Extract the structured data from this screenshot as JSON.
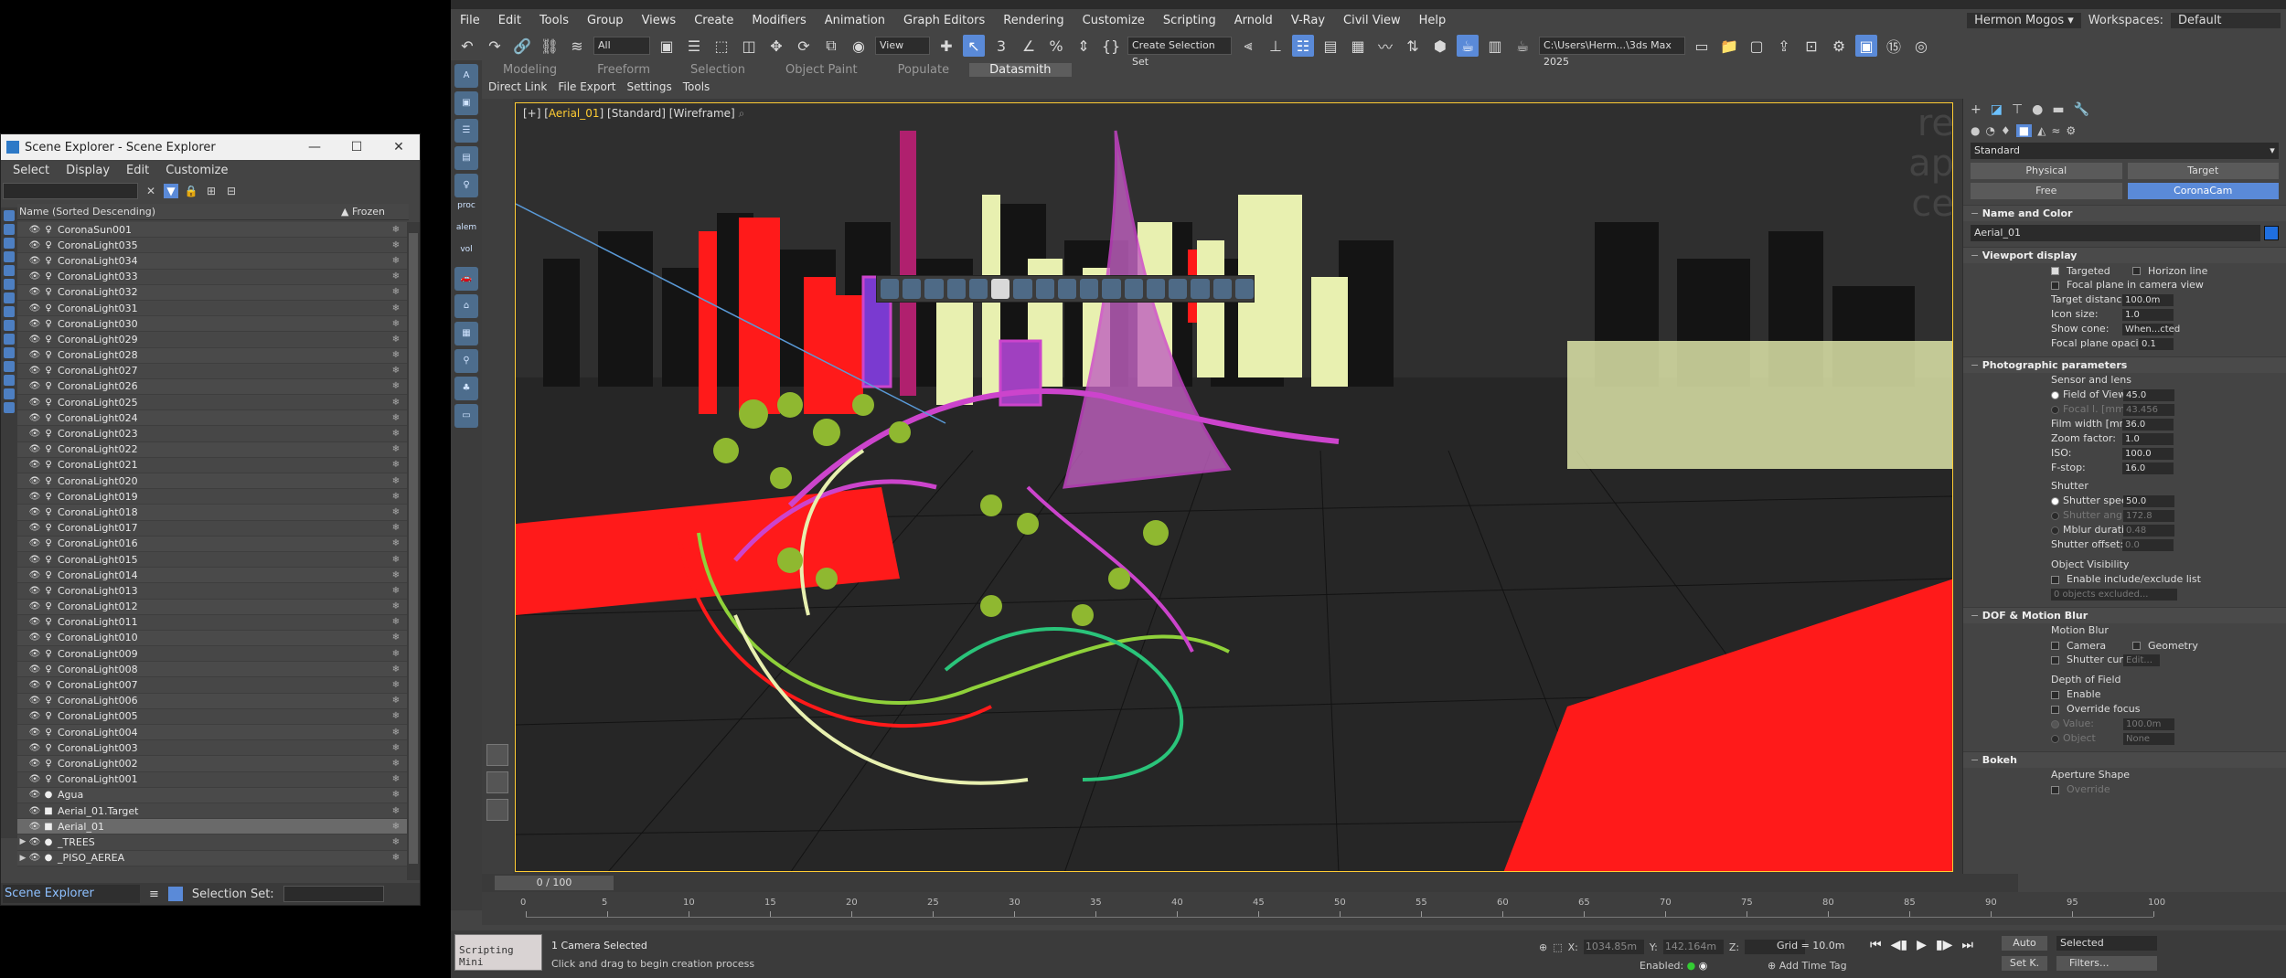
{
  "scene_explorer": {
    "title": "Scene Explorer - Scene Explorer",
    "menu": [
      "Select",
      "Display",
      "Edit",
      "Customize"
    ],
    "col_name": "Name (Sorted Descending)",
    "col_frozen": "Frozen",
    "rows": [
      "CoronaSun001",
      "CoronaLight035",
      "CoronaLight034",
      "CoronaLight033",
      "CoronaLight032",
      "CoronaLight031",
      "CoronaLight030",
      "CoronaLight029",
      "CoronaLight028",
      "CoronaLight027",
      "CoronaLight026",
      "CoronaLight025",
      "CoronaLight024",
      "CoronaLight023",
      "CoronaLight022",
      "CoronaLight021",
      "CoronaLight020",
      "CoronaLight019",
      "CoronaLight018",
      "CoronaLight017",
      "CoronaLight016",
      "CoronaLight015",
      "CoronaLight014",
      "CoronaLight013",
      "CoronaLight012",
      "CoronaLight011",
      "CoronaLight010",
      "CoronaLight009",
      "CoronaLight008",
      "CoronaLight007",
      "CoronaLight006",
      "CoronaLight005",
      "CoronaLight004",
      "CoronaLight003",
      "CoronaLight002",
      "CoronaLight001",
      "Agua",
      "Aerial_01.Target",
      "Aerial_01",
      "_TREES",
      "_PISO_AEREA"
    ],
    "selected_row": "Aerial_01",
    "footer_name": "Scene Explorer",
    "selection_set_label": "Selection Set:"
  },
  "max": {
    "menu": [
      "File",
      "Edit",
      "Tools",
      "Group",
      "Views",
      "Create",
      "Modifiers",
      "Animation",
      "Graph Editors",
      "Rendering",
      "Customize",
      "Scripting",
      "Arnold",
      "V-Ray",
      "Civil View",
      "Help"
    ],
    "user": "Hermon Mogos",
    "workspaces_label": "Workspaces:",
    "workspace": "Default",
    "filter_all": "All",
    "ref_coord": "View",
    "selset": "Create Selection Set",
    "path": "C:\\Users\\Herm...\\3ds Max 2025",
    "ribbon_tabs": [
      "Modeling",
      "Freeform",
      "Selection",
      "Object Paint",
      "Populate",
      "Datasmith"
    ],
    "ribbon_active": "Datasmith",
    "subribbon": [
      "Direct Link",
      "File Export",
      "Settings",
      "Tools"
    ],
    "left_labels": [
      "proc",
      "alem",
      "vol"
    ]
  },
  "viewport": {
    "label_prefix": "[+] [",
    "camera": "Aerial_01",
    "label_suffix": "] [Standard] [Wireframe]",
    "ghost_text": [
      "re",
      "ap",
      "ce"
    ]
  },
  "command_panel": {
    "type_dropdown": "Standard",
    "btn_physical": "Physical",
    "btn_target": "Target",
    "btn_free": "Free",
    "btn_coronacam": "CoronaCam",
    "name_color_header": "Name and Color",
    "object_name": "Aerial_01",
    "viewport_display_header": "Viewport display",
    "cb_targeted": "Targeted",
    "cb_horizon": "Horizon line",
    "cb_focal_plane": "Focal plane in camera view",
    "target_distance_label": "Target distance:",
    "target_distance": "100.0m",
    "icon_size_label": "Icon size:",
    "icon_size": "1.0",
    "show_cone_label": "Show cone:",
    "show_cone": "When...cted",
    "focal_opacity_label": "Focal plane opacity:",
    "focal_opacity": "0.1",
    "photo_header": "Photographic parameters",
    "sensor_lens": "Sensor and lens",
    "fov_label": "Field of View",
    "fov": "45.0",
    "focal_len_label": "Focal l. [mm]",
    "focal_len": "43.456",
    "film_width_label": "Film width [mm]",
    "film_width": "36.0",
    "zoom_label": "Zoom factor:",
    "zoom": "1.0",
    "iso_label": "ISO:",
    "iso": "100.0",
    "fstop_label": "F-stop:",
    "fstop": "16.0",
    "shutter": "Shutter",
    "shutter_speed_label": "Shutter speed:",
    "shutter_speed": "50.0",
    "shutter_angle_label": "Shutter angle:",
    "shutter_angle": "172.8",
    "mblur_label": "Mblur duration:",
    "mblur": "0.48",
    "shutter_offset_label": "Shutter offset:",
    "shutter_offset": "0.0",
    "object_visibility": "Object Visibility",
    "cb_include_exclude": "Enable include/exclude list",
    "objects_excluded": "0 objects excluded...",
    "dof_header": "DOF & Motion Blur",
    "motion_blur": "Motion Blur",
    "cb_camera": "Camera",
    "cb_geometry": "Geometry",
    "cb_shutter_curve": "Shutter curve:",
    "shutter_curve_btn": "Edit...",
    "dof": "Depth of Field",
    "cb_enable": "Enable",
    "cb_override_focus": "Override focus",
    "value_label": "Value:",
    "value": "100.0m",
    "object_label": "Object",
    "object_value": "None",
    "bokeh_header": "Bokeh",
    "aperture_shape": "Aperture Shape",
    "override": "Override"
  },
  "timeline": {
    "slider": "0 / 100",
    "ticks": [
      "0",
      "5",
      "10",
      "15",
      "20",
      "25",
      "30",
      "35",
      "40",
      "45",
      "50",
      "55",
      "60",
      "65",
      "70",
      "75",
      "80",
      "85",
      "90",
      "95",
      "100"
    ]
  },
  "status": {
    "mini": "Scripting Mini",
    "line1": "1 Camera Selected",
    "line2": "Click and drag to begin creation process",
    "x_label": "X:",
    "x": "1034.85m",
    "y_label": "Y:",
    "y": "142.164m",
    "z_label": "Z:",
    "z": "",
    "grid": "Grid = 10.0m",
    "enabled": "Enabled:",
    "add_time_tag": "Add Time Tag",
    "auto": "Auto",
    "set_key": "Set K.",
    "selected": "Selected",
    "filters": "Filters...",
    "frame": "0"
  },
  "colors": {
    "accent": "#5a8ad8",
    "viewport_border": "#ffcc33",
    "wire_red": "#ff1a1a",
    "wire_magenta": "#cc44cc",
    "wire_cream": "#e8f0b0",
    "wire_green": "#8fd13a",
    "wire_black": "#151515"
  }
}
